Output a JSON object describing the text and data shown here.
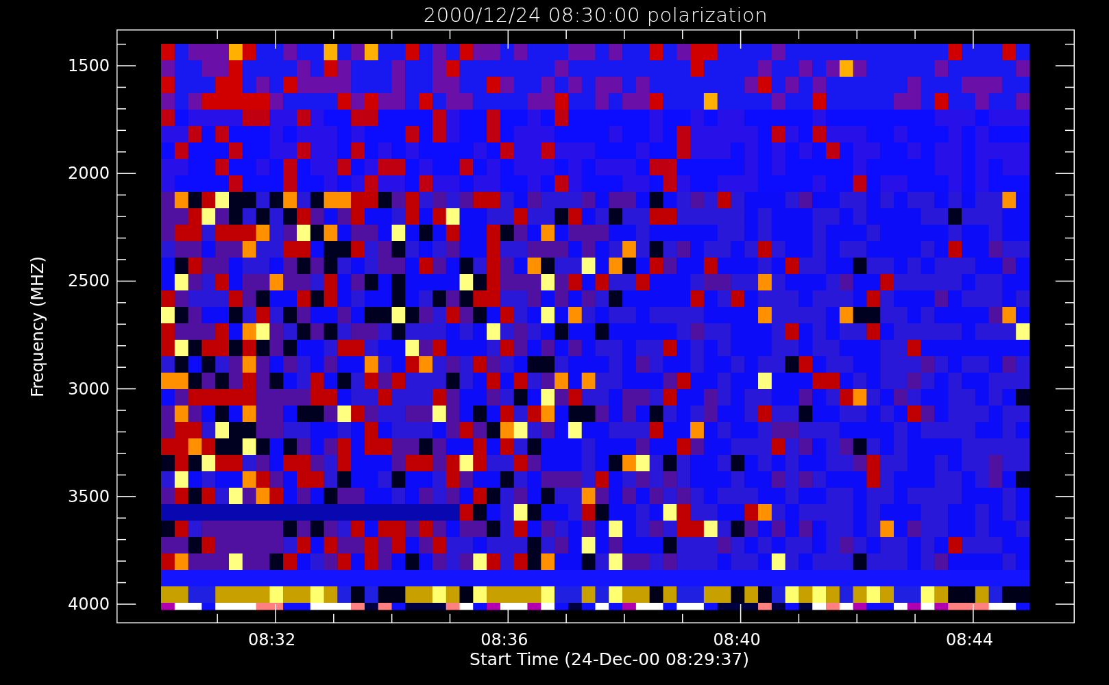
{
  "title": "2000/12/24 08:30:00 polarization",
  "y_axis": {
    "label": "Frequency (MHZ)",
    "ticks": [
      "1500",
      "2000",
      "2500",
      "3000",
      "3500",
      "4000"
    ]
  },
  "x_axis": {
    "label": "Start Time (24-Dec-00 08:29:37)",
    "ticks": [
      "08:32",
      "08:36",
      "08:40",
      "08:44"
    ]
  }
}
